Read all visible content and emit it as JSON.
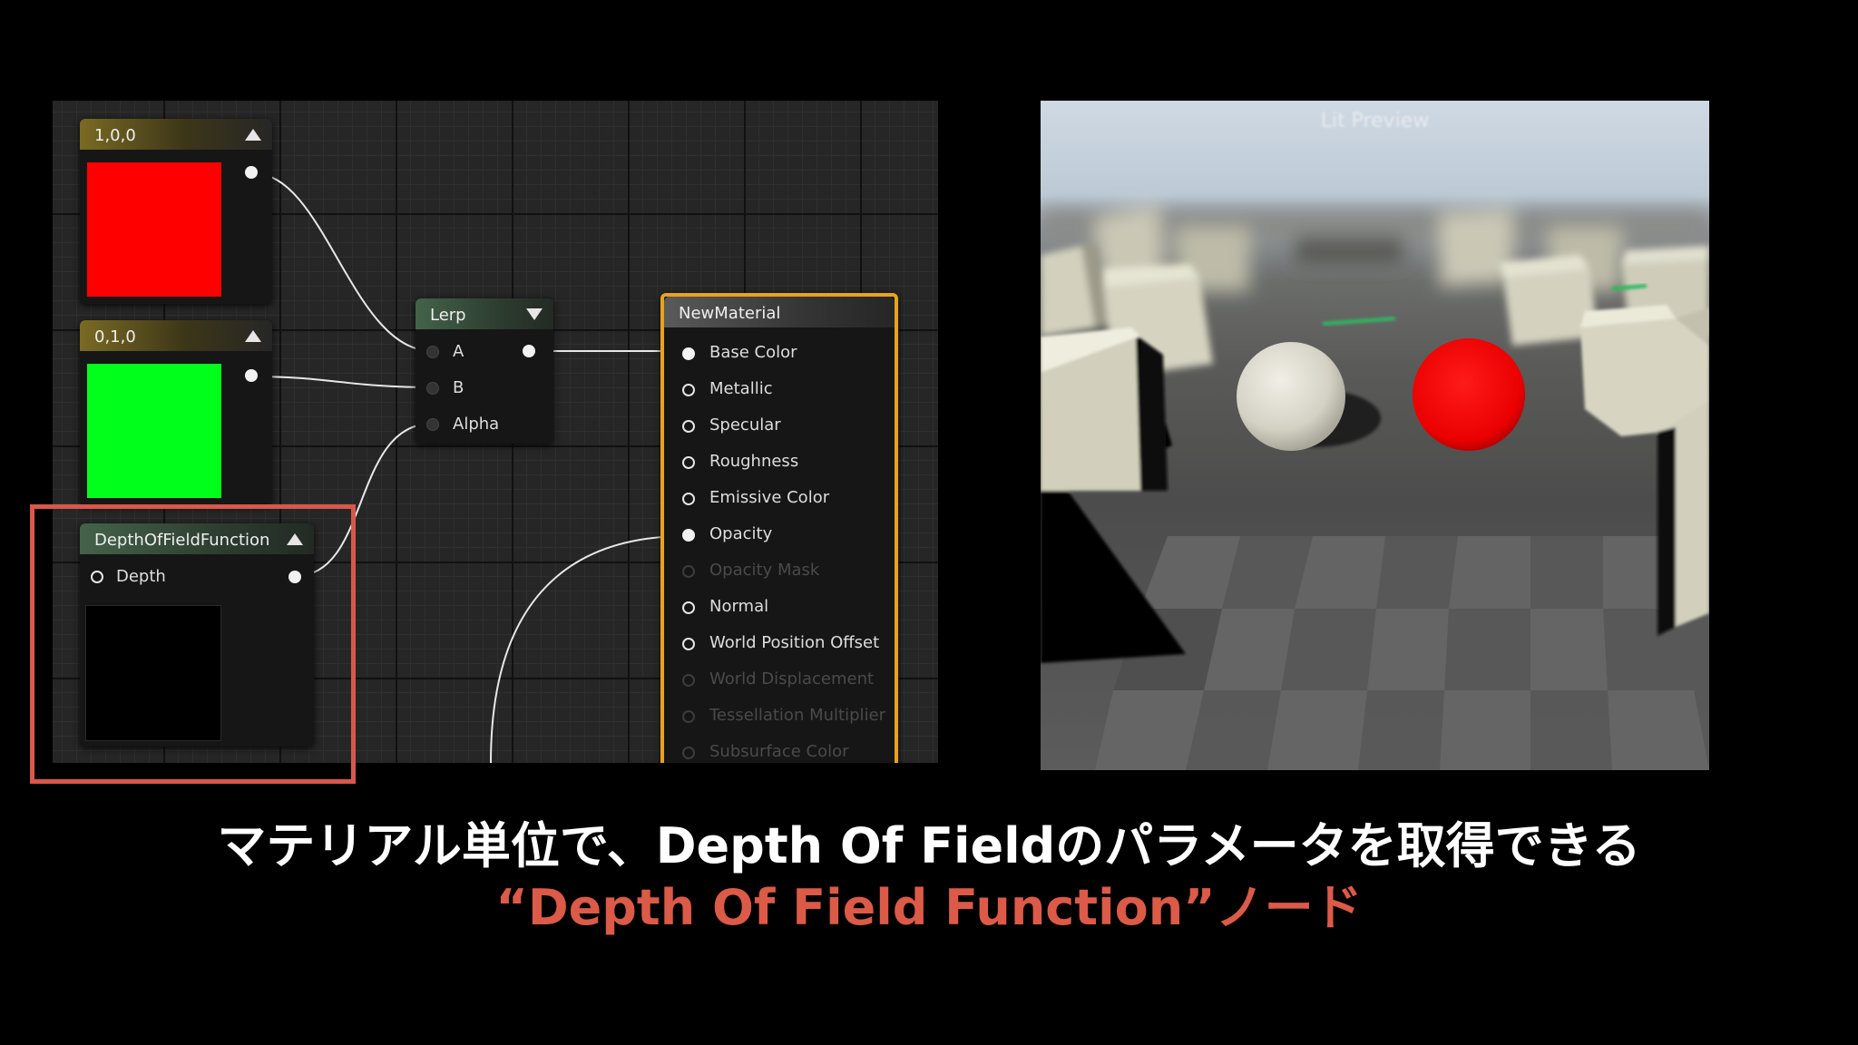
{
  "graph": {
    "nodes": {
      "const_red": {
        "title": "1,0,0",
        "color": "#ff0000"
      },
      "const_green": {
        "title": "0,1,0",
        "color": "#00ff1a"
      },
      "lerp": {
        "title": "Lerp",
        "inputs": [
          "A",
          "B",
          "Alpha"
        ]
      },
      "dof": {
        "title": "DepthOfFieldFunction",
        "input": "Depth",
        "preview_color": "#000000"
      },
      "material": {
        "title": "NewMaterial",
        "pins": [
          {
            "label": "Base Color",
            "state": "filled"
          },
          {
            "label": "Metallic",
            "state": "hollow"
          },
          {
            "label": "Specular",
            "state": "hollow"
          },
          {
            "label": "Roughness",
            "state": "hollow"
          },
          {
            "label": "Emissive Color",
            "state": "hollow"
          },
          {
            "label": "Opacity",
            "state": "filled"
          },
          {
            "label": "Opacity Mask",
            "state": "disabled"
          },
          {
            "label": "Normal",
            "state": "hollow"
          },
          {
            "label": "World Position Offset",
            "state": "hollow"
          },
          {
            "label": "World Displacement",
            "state": "disabled"
          },
          {
            "label": "Tessellation Multiplier",
            "state": "disabled"
          },
          {
            "label": "Subsurface Color",
            "state": "disabled"
          }
        ]
      }
    },
    "highlight_color": "#d9574b",
    "accent_border": "#e8a21c"
  },
  "viewport": {
    "title": "Lit Preview"
  },
  "caption": {
    "line1": "マテリアル単位で、Depth Of Fieldのパラメータを取得できる",
    "line2": "“Depth Of Field Function”ノード",
    "line2_color": "#dc5a48"
  }
}
